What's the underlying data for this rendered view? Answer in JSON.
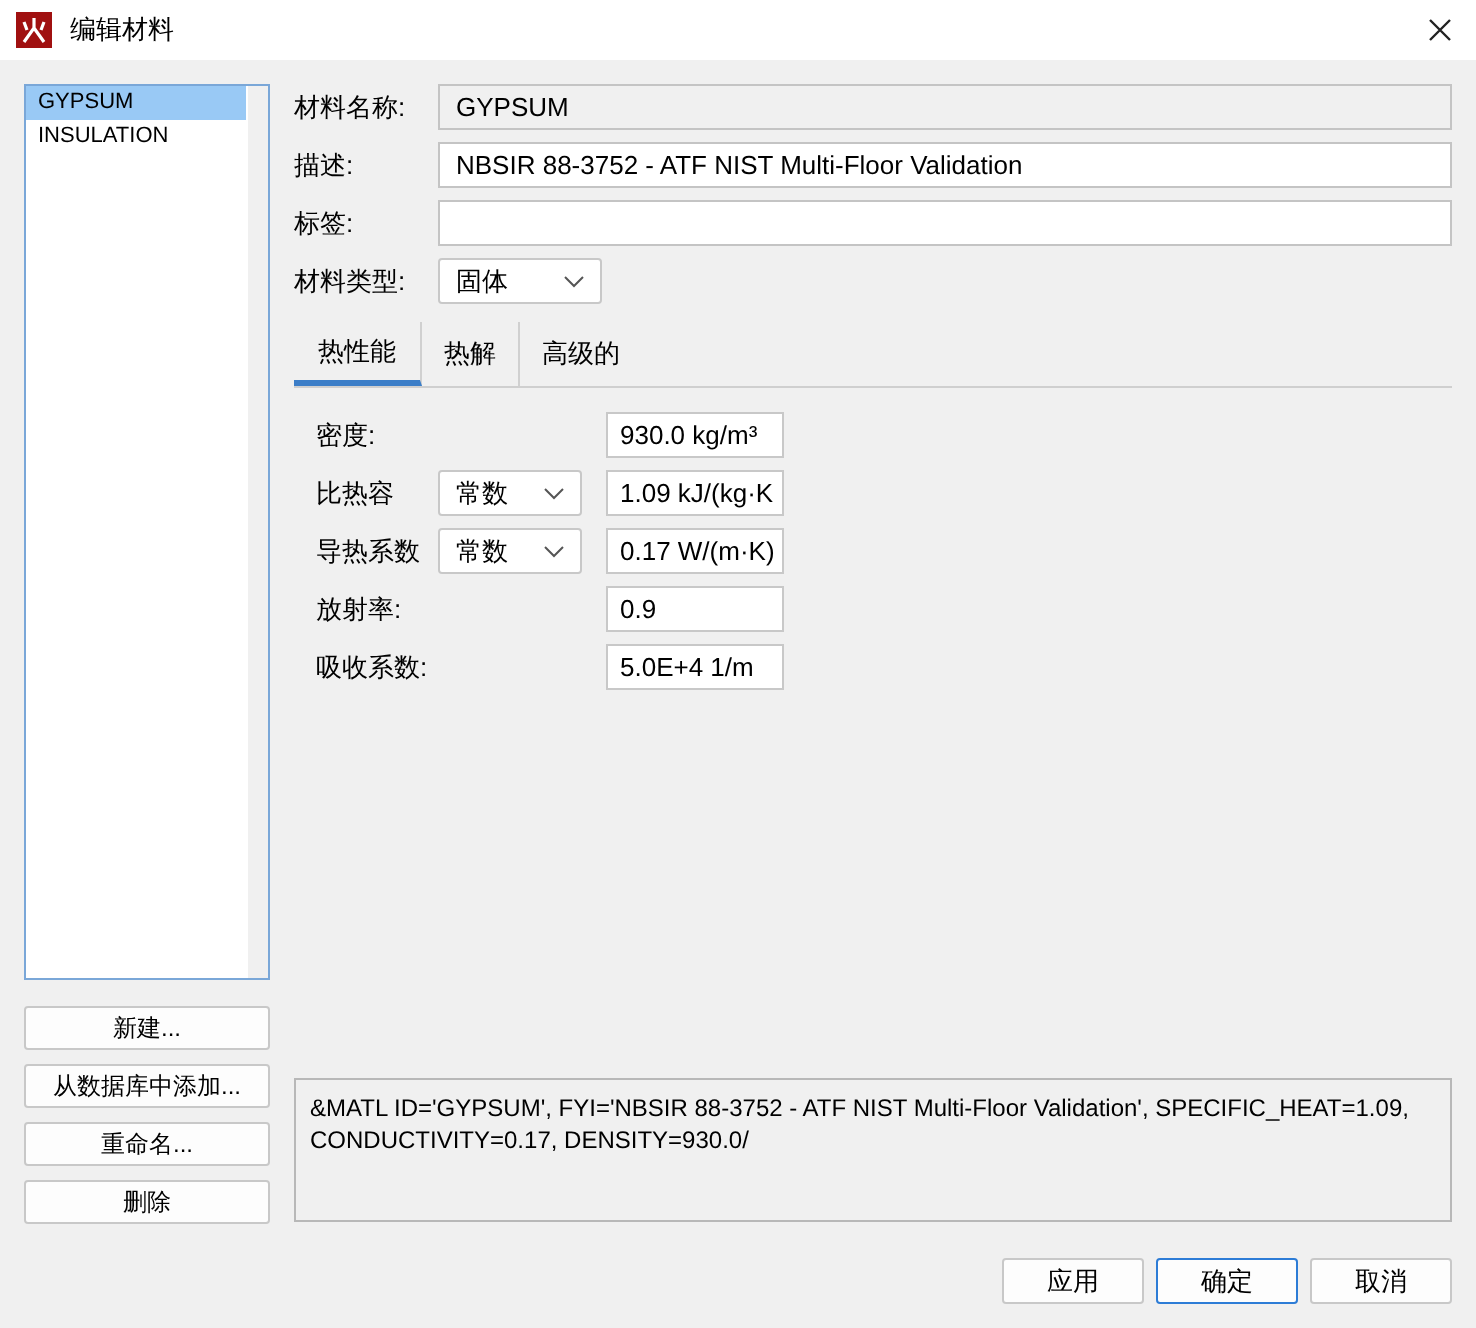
{
  "window": {
    "title": "编辑材料"
  },
  "materials": [
    {
      "name": "GYPSUM",
      "selected": true
    },
    {
      "name": "INSULATION",
      "selected": false
    }
  ],
  "list_buttons": [
    "新建...",
    "从数据库中添加...",
    "重命名...",
    "删除"
  ],
  "fields": [
    {
      "label": "材料名称:",
      "value": "GYPSUM",
      "disabled": true
    },
    {
      "label": "描述:",
      "value": "NBSIR 88-3752 - ATF NIST Multi-Floor Validation",
      "disabled": false
    },
    {
      "label": "标签:",
      "disabled": false
    }
  ],
  "material_type": {
    "label": "材料类型:",
    "value": "固体"
  },
  "tabs": [
    {
      "label": "热性能",
      "selected": true
    },
    {
      "label": "热解",
      "selected": false
    },
    {
      "label": "高级的",
      "selected": false
    }
  ],
  "properties": [
    {
      "kind": "value",
      "label": "密度:",
      "value": "930.0 kg/m³"
    },
    {
      "kind": "select",
      "label": "比热容",
      "mode": "常数",
      "value": "1.09 kJ/(kg·K"
    },
    {
      "kind": "select",
      "label": "导热系数",
      "mode": "常数",
      "value": "0.17 W/(m·K)"
    },
    {
      "kind": "value",
      "label": "放射率:",
      "value": "0.9"
    },
    {
      "kind": "value",
      "label": "吸收系数:",
      "value": "5.0E+4 1/m"
    }
  ],
  "fds_text": "&MATL ID='GYPSUM', FYI='NBSIR 88-3752 - ATF NIST Multi-Floor Validation', SPECIFIC_HEAT=1.09, CONDUCTIVITY=0.17, DENSITY=930.0/",
  "buttons": [
    {
      "label": "应用",
      "default": false
    },
    {
      "label": "确定",
      "default": true
    },
    {
      "label": "取消",
      "default": false
    }
  ]
}
